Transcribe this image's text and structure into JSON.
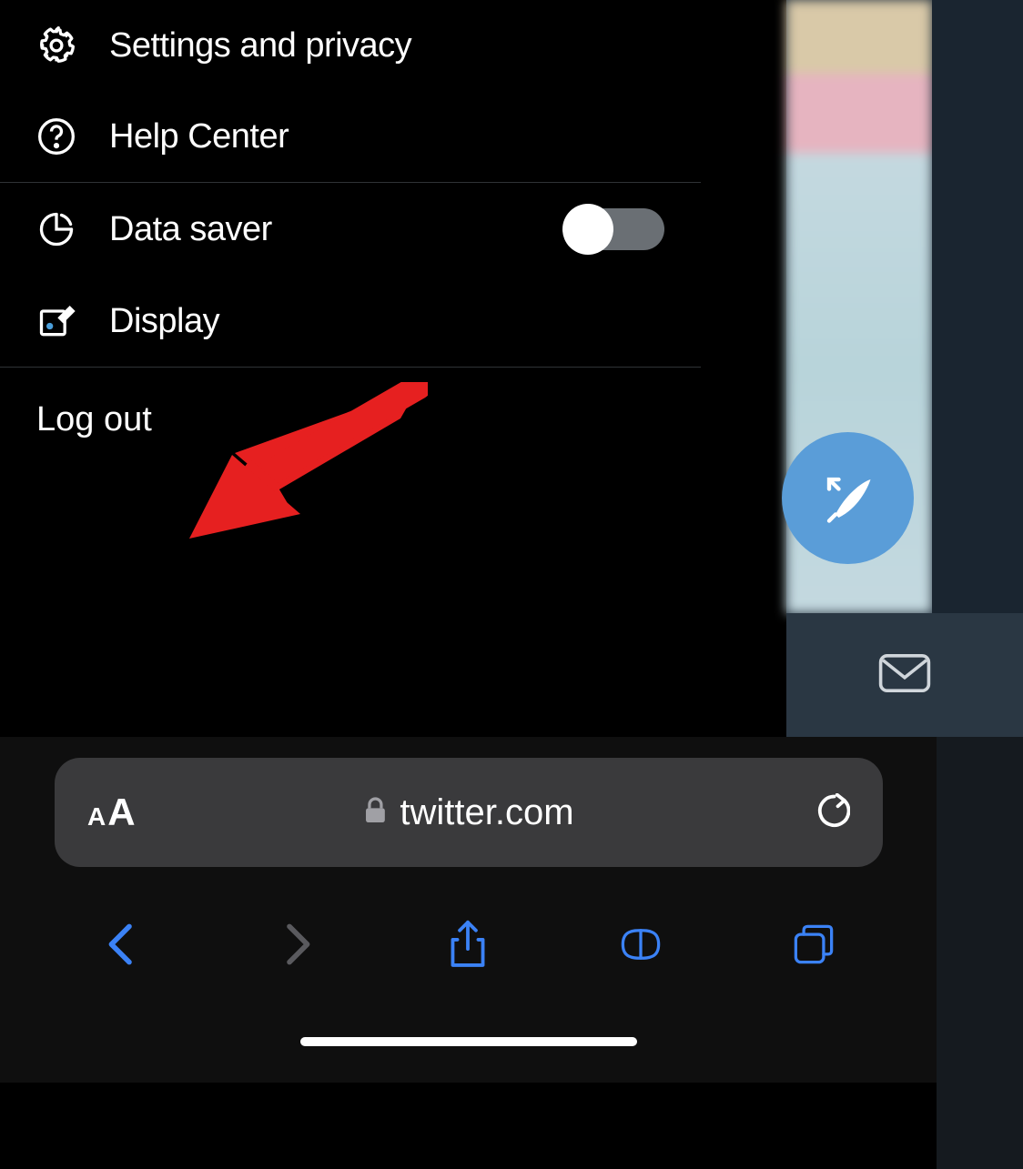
{
  "menu": {
    "settings_label": "Settings and privacy",
    "help_label": "Help Center",
    "data_saver_label": "Data saver",
    "data_saver_on": false,
    "display_label": "Display",
    "logout_label": "Log out"
  },
  "compose": {
    "icon": "compose-feather"
  },
  "bottom_nav": {
    "messages_icon": "envelope"
  },
  "safari": {
    "url": "twitter.com",
    "text_size_icon": "aA",
    "colors": {
      "active": "#3b82f6",
      "inactive": "#5a5a5e"
    }
  },
  "annotation": {
    "arrow_color": "#e62020",
    "points_to": "logout"
  }
}
